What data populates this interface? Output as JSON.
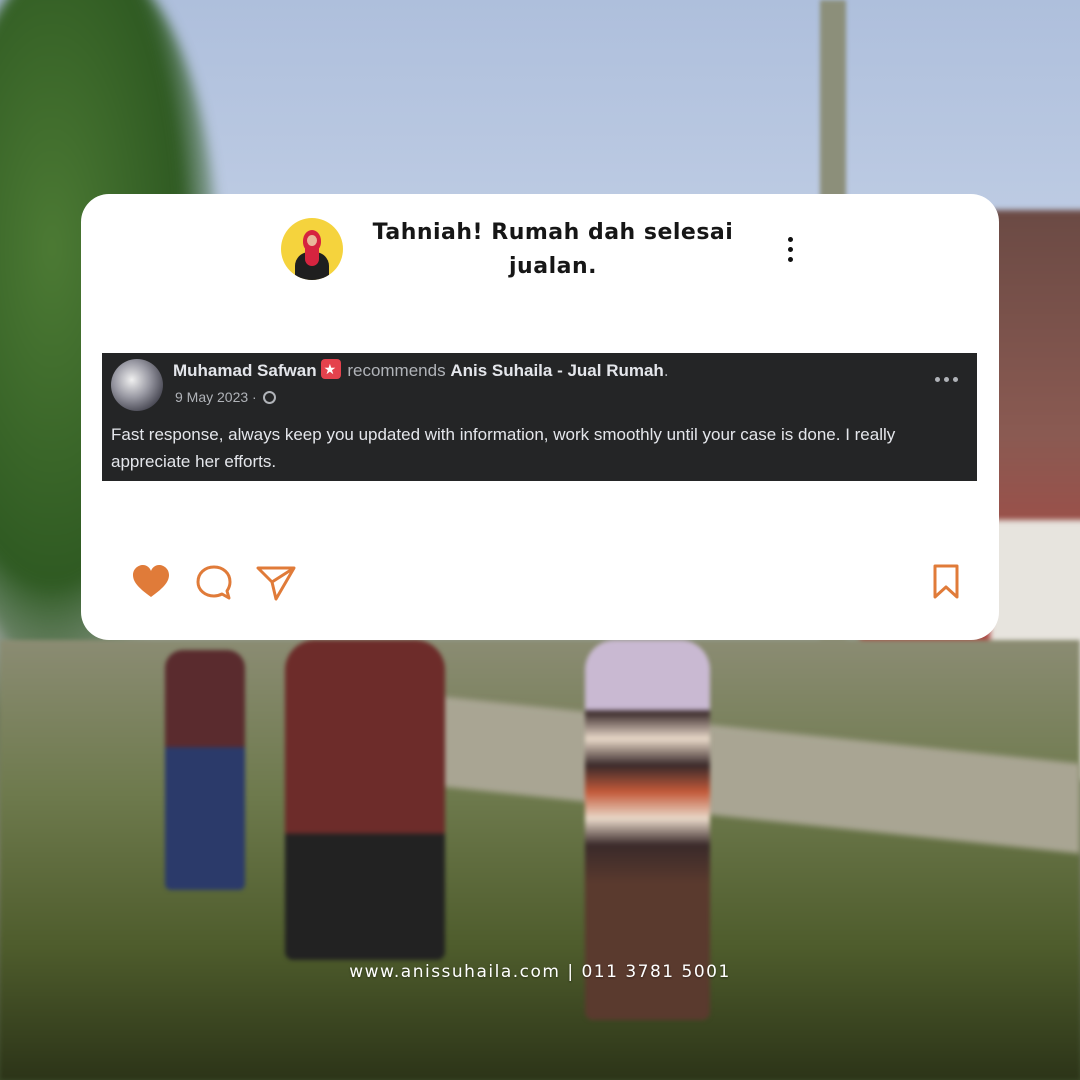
{
  "post": {
    "title": "Tahniah! Rumah dah selesai jualan."
  },
  "review": {
    "reviewer_name": "Muhamad Safwan",
    "action_text": "recommends",
    "page_name": "Anis Suhaila - Jual Rumah",
    "page_suffix": ".",
    "date": "9 May 2023 ·",
    "body": "Fast response, always keep you updated with information, work smoothly until your case is done. I really appreciate her efforts."
  },
  "actions": {
    "icons": [
      "heart-icon",
      "comment-icon",
      "send-icon",
      "bookmark-icon"
    ],
    "accent_color": "#e07b39"
  },
  "footer": {
    "contact": "www.anissuhaila.com | 011 3781 5001"
  },
  "colors": {
    "card_bg": "#ffffff",
    "fb_bg": "#242526",
    "accent": "#e07b39"
  }
}
